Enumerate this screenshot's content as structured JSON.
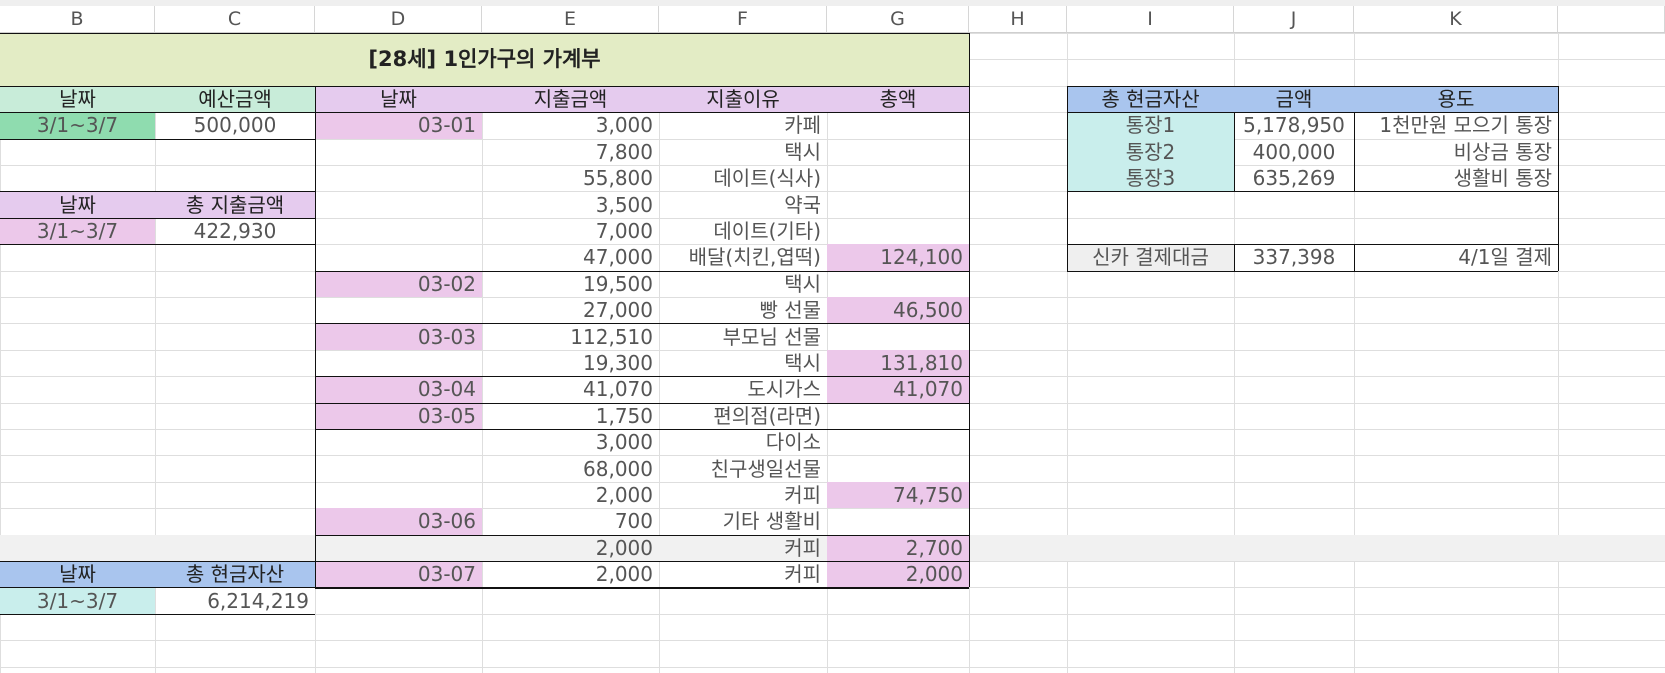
{
  "columns": [
    "B",
    "C",
    "D",
    "E",
    "F",
    "G",
    "H",
    "I",
    "J",
    "K"
  ],
  "title": "[28세] 1인가구의 가계부",
  "budget": {
    "header_date": "날짜",
    "header_amount": "예산금액",
    "date": "3/1~3/7",
    "amount": "500,000"
  },
  "spend_total": {
    "header_date": "날짜",
    "header_amount": "총 지출금액",
    "date": "3/1~3/7",
    "amount": "422,930"
  },
  "cash_total": {
    "header_date": "날짜",
    "header_amount": "총 현금자산",
    "date": "3/1~3/7",
    "amount": "6,214,219"
  },
  "ledger": {
    "headers": [
      "날짜",
      "지출금액",
      "지출이유",
      "총액"
    ],
    "rows": [
      {
        "date": "03-01",
        "amount": "3,000",
        "reason": "카페",
        "total": ""
      },
      {
        "date": "",
        "amount": "7,800",
        "reason": "택시",
        "total": ""
      },
      {
        "date": "",
        "amount": "55,800",
        "reason": "데이트(식사)",
        "total": ""
      },
      {
        "date": "",
        "amount": "3,500",
        "reason": "약국",
        "total": ""
      },
      {
        "date": "",
        "amount": "7,000",
        "reason": "데이트(기타)",
        "total": ""
      },
      {
        "date": "",
        "amount": "47,000",
        "reason": "배달(치킨,엽떡)",
        "total": "124,100"
      },
      {
        "date": "03-02",
        "amount": "19,500",
        "reason": "택시",
        "total": ""
      },
      {
        "date": "",
        "amount": "27,000",
        "reason": "빵 선물",
        "total": "46,500"
      },
      {
        "date": "03-03",
        "amount": "112,510",
        "reason": "부모님 선물",
        "total": ""
      },
      {
        "date": "",
        "amount": "19,300",
        "reason": "택시",
        "total": "131,810"
      },
      {
        "date": "03-04",
        "amount": "41,070",
        "reason": "도시가스",
        "total": "41,070"
      },
      {
        "date": "03-05",
        "amount": "1,750",
        "reason": "편의점(라면)",
        "total": ""
      },
      {
        "date": "",
        "amount": "3,000",
        "reason": "다이소",
        "total": ""
      },
      {
        "date": "",
        "amount": "68,000",
        "reason": "친구생일선물",
        "total": ""
      },
      {
        "date": "",
        "amount": "2,000",
        "reason": "커피",
        "total": "74,750"
      },
      {
        "date": "03-06",
        "amount": "700",
        "reason": "기타 생활비",
        "total": ""
      },
      {
        "date": "",
        "amount": "2,000",
        "reason": "커피",
        "total": "2,700"
      },
      {
        "date": "03-07",
        "amount": "2,000",
        "reason": "커피",
        "total": "2,000"
      }
    ]
  },
  "assets": {
    "headers": [
      "총 현금자산",
      "금액",
      "용도"
    ],
    "rows": [
      {
        "name": "통장1",
        "amount": "5,178,950",
        "purpose": "1천만원 모으기 통장"
      },
      {
        "name": "통장2",
        "amount": "400,000",
        "purpose": "비상금 통장"
      },
      {
        "name": "통장3",
        "amount": "635,269",
        "purpose": "생활비 통장"
      }
    ],
    "card": {
      "name": "신카 결제대금",
      "amount": "337,398",
      "purpose": "4/1일 결제"
    }
  },
  "colors": {
    "title_bg": "#e3ecc5",
    "green_header": "#c8ecd9",
    "green_cell": "#8fdcaf",
    "pink": "#ecc8ea",
    "purple_header": "#e5cbee",
    "blue_header": "#a9c5ee",
    "teal": "#c9eeec",
    "gray_row": "#f1f1f1"
  }
}
